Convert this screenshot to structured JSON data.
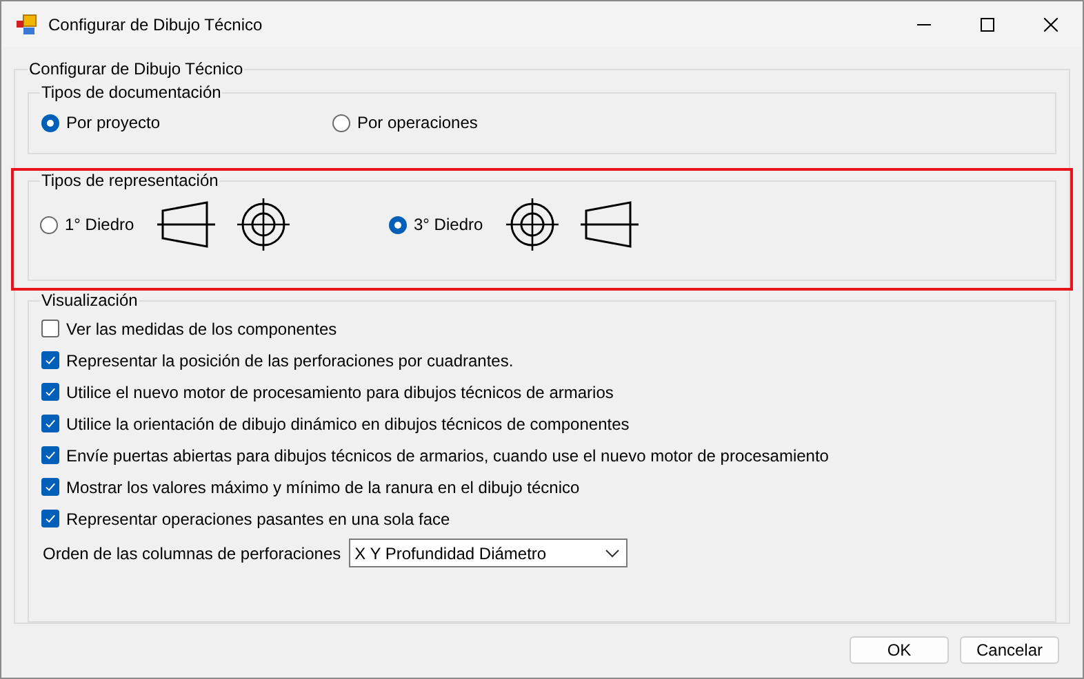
{
  "window": {
    "title": "Configurar de Dibujo Técnico"
  },
  "main_group": {
    "title": "Configurar de Dibujo Técnico"
  },
  "documentation": {
    "title": "Tipos de documentación",
    "options": [
      {
        "label": "Por proyecto",
        "selected": true
      },
      {
        "label": "Por operaciones",
        "selected": false
      }
    ]
  },
  "representation": {
    "title": "Tipos de representación",
    "highlighted": true,
    "options": [
      {
        "label": "1° Diedro",
        "selected": false,
        "views": [
          {
            "kind": "side"
          },
          {
            "kind": "front"
          }
        ]
      },
      {
        "label": "3° Diedro",
        "selected": true,
        "views": [
          {
            "kind": "front"
          },
          {
            "kind": "side"
          }
        ]
      }
    ]
  },
  "visualization": {
    "title": "Visualización",
    "checkboxes": [
      {
        "label": "Ver las medidas de los componentes",
        "checked": false
      },
      {
        "label": "Representar la posición de las perforaciones por cuadrantes.",
        "checked": true
      },
      {
        "label": "Utilice el nuevo motor de procesamiento para dibujos técnicos de armarios",
        "checked": true
      },
      {
        "label": "Utilice la orientación de dibujo dinámico en dibujos técnicos de componentes",
        "checked": true
      },
      {
        "label": "Envíe puertas abiertas para dibujos técnicos de armarios, cuando use el nuevo motor de procesamiento",
        "checked": true
      },
      {
        "label": "Mostrar los valores máximo y mínimo de la ranura en el dibujo técnico",
        "checked": true
      },
      {
        "label": "Representar operaciones pasantes en una sola face",
        "checked": true
      }
    ],
    "column_order": {
      "label": "Orden de las columnas de perforaciones",
      "value": "X Y Profundidad Diámetro"
    }
  },
  "buttons": [
    "OK",
    "Cancelar"
  ]
}
